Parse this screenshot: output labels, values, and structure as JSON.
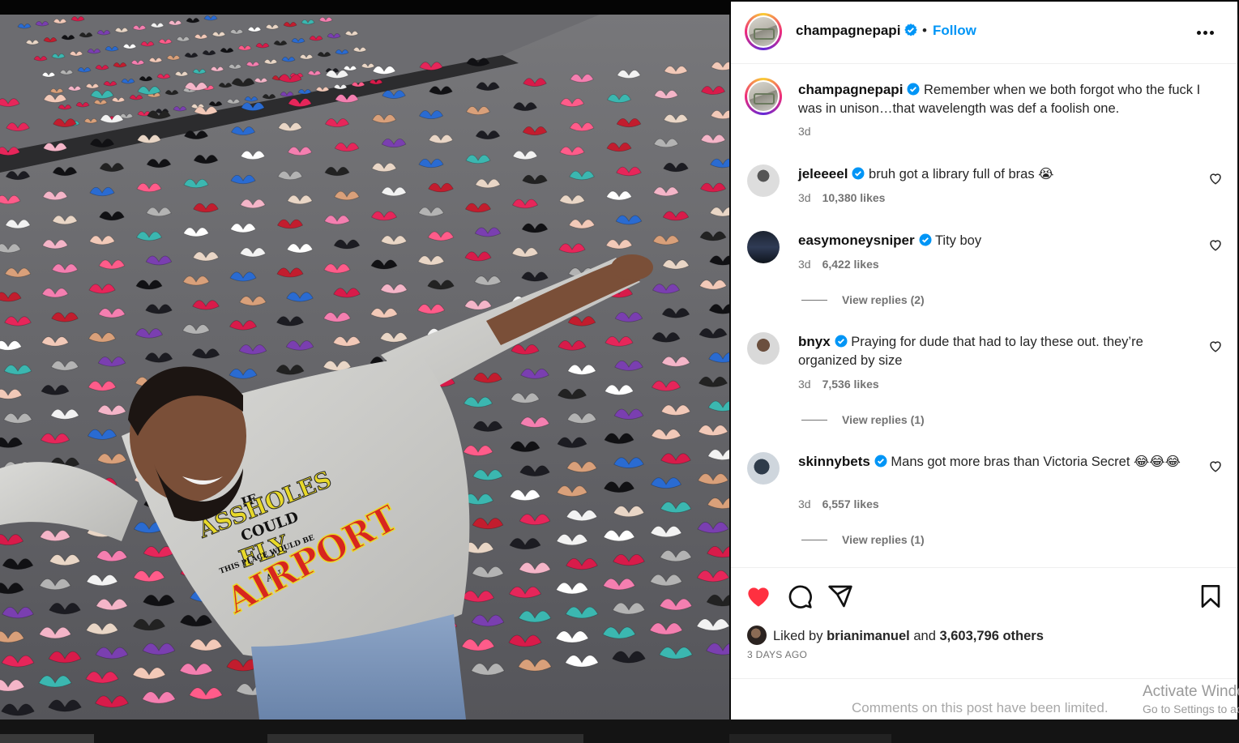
{
  "post": {
    "username": "champagnepapi",
    "follow_label": "Follow",
    "separator": "•",
    "caption": "Remember when we both forgot who the fuck I was in unison…that wavelength was def a foolish one.",
    "caption_time": "3d"
  },
  "comments": [
    {
      "username": "jeleeeel",
      "text": "bruh got a library full of bras",
      "emoji": "😭",
      "time": "3d",
      "likes": "10,380 likes"
    },
    {
      "username": "easymoneysniper",
      "text": "Tity boy",
      "time": "3d",
      "likes": "6,422 likes",
      "replies": "View replies (2)"
    },
    {
      "username": "bnyx",
      "text": "Praying for dude that had to lay these out. they’re organized by size",
      "time": "3d",
      "likes": "7,536 likes",
      "replies": "View replies (1)"
    },
    {
      "username": "skinnybets",
      "text": "Mans got more bras than Victoria Secret",
      "emoji": "😂😂😂",
      "time": "3d",
      "likes": "6,557 likes",
      "replies": "View replies (1)"
    }
  ],
  "engagement": {
    "liked_by_prefix": "Liked by",
    "liked_by_user": "brianimanuel",
    "liked_by_suffix": "and",
    "others": "3,603,796 others",
    "date": "3 DAYS AGO",
    "liked": true
  },
  "comments_limited": "Comments on this post have been limited.",
  "windows_watermark": {
    "line1": "Activate Windows",
    "line2": "Go to Settings to activate Windows."
  },
  "photo": {
    "shirt_lines": [
      "IF",
      "ASSHOLES",
      "COULD",
      "FLY",
      "THIS PLACE WOULD BE",
      "AN",
      "AIRPORT"
    ]
  },
  "icons": {
    "verified": "verified-badge-icon",
    "more": "more-options-icon",
    "like": "heart-icon",
    "comment": "comment-bubble-icon",
    "share": "paper-plane-icon",
    "save": "bookmark-icon"
  },
  "colors": {
    "link_blue": "#0095f6",
    "verified_blue": "#0095f6",
    "heart_red": "#ff3040",
    "muted_text": "#737373"
  }
}
